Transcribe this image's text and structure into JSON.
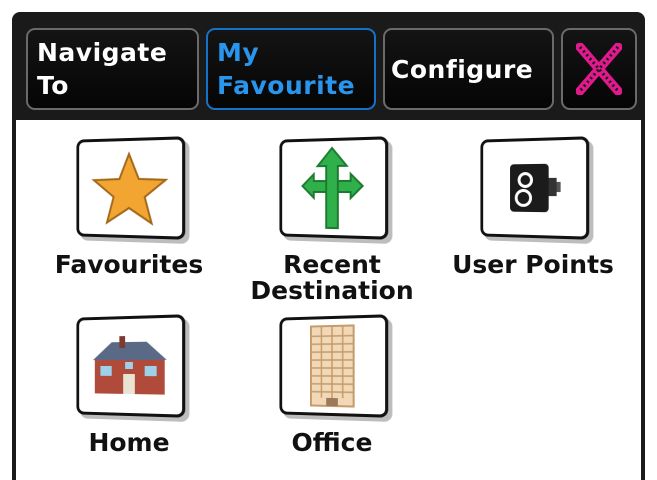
{
  "tabs": {
    "navigate_to": "Navigate\nTo",
    "my_favourite": "My\nFavourite",
    "configure": "Configure"
  },
  "items": {
    "favourites": "Favourites",
    "recent_destination": "Recent\nDestination",
    "user_points": "User Points",
    "home": "Home",
    "office": "Office"
  },
  "colors": {
    "active_tab": "#2a95ec",
    "close_icon": "#e0198c",
    "star": "#f2a531",
    "arrow": "#2fb04a"
  },
  "icons": [
    "star-icon",
    "arrows-icon",
    "speed-camera-icon",
    "house-icon",
    "office-building-icon",
    "close-icon"
  ]
}
